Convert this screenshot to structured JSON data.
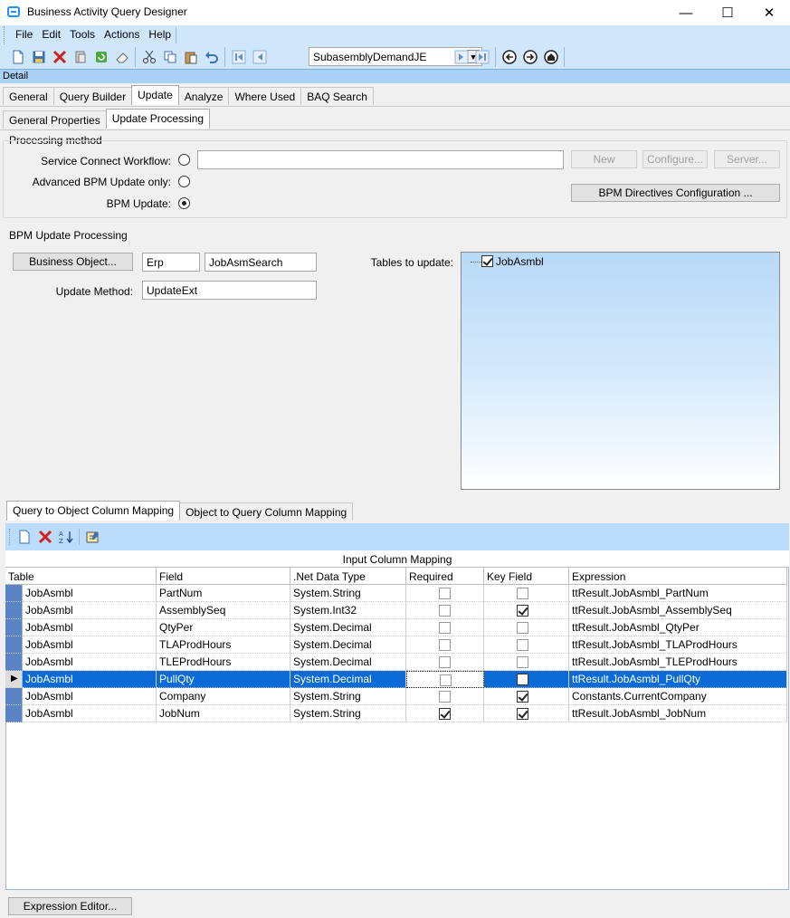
{
  "window": {
    "title": "Business Activity Query Designer"
  },
  "menu": [
    "File",
    "Edit",
    "Tools",
    "Actions",
    "Help"
  ],
  "toolbar": {
    "query_id": "SubasemblyDemandJE"
  },
  "detail_label": "Detail",
  "main_tabs": [
    "General",
    "Query Builder",
    "Update",
    "Analyze",
    "Where Used",
    "BAQ Search"
  ],
  "sub_tabs": [
    "General Properties",
    "Update  Processing"
  ],
  "processing": {
    "group_label": "Processing method",
    "service_connect_label": "Service Connect Workflow:",
    "advanced_bpm_label": "Advanced BPM Update only:",
    "bpm_update_label": "BPM Update:",
    "workflow_value": "",
    "new_button": "New",
    "configure_button": "Configure...",
    "server_button": "Server...",
    "bpm_directives_button": "BPM Directives Configuration ...",
    "selected": "bpm_update"
  },
  "bpm_update": {
    "group_label": "BPM Update Processing",
    "business_object_button": "Business Object...",
    "bo_namespace": "Erp",
    "bo_name": "JobAsmSearch",
    "update_method_label": "Update Method:",
    "update_method": "UpdateExt",
    "tables_label": "Tables to update:",
    "tables": [
      {
        "name": "JobAsmbl",
        "checked": true
      }
    ]
  },
  "mapping_tabs": [
    "Query to Object Column Mapping",
    "Object to Query Column Mapping"
  ],
  "grid": {
    "band_title": "Input Column Mapping",
    "columns": [
      "Table",
      "Field",
      ".Net Data Type",
      "Required",
      "Key Field",
      "Expression"
    ],
    "rows": [
      {
        "table": "JobAsmbl",
        "field": "PartNum",
        "type": "System.String",
        "required": false,
        "key": false,
        "expression": "ttResult.JobAsmbl_PartNum"
      },
      {
        "table": "JobAsmbl",
        "field": "AssemblySeq",
        "type": "System.Int32",
        "required": false,
        "key": true,
        "expression": "ttResult.JobAsmbl_AssemblySeq"
      },
      {
        "table": "JobAsmbl",
        "field": "QtyPer",
        "type": "System.Decimal",
        "required": false,
        "key": false,
        "expression": "ttResult.JobAsmbl_QtyPer"
      },
      {
        "table": "JobAsmbl",
        "field": "TLAProdHours",
        "type": "System.Decimal",
        "required": false,
        "key": false,
        "expression": "ttResult.JobAsmbl_TLAProdHours"
      },
      {
        "table": "JobAsmbl",
        "field": "TLEProdHours",
        "type": "System.Decimal",
        "required": false,
        "key": false,
        "expression": "ttResult.JobAsmbl_TLEProdHours"
      },
      {
        "table": "JobAsmbl",
        "field": "PullQty",
        "type": "System.Decimal",
        "required": false,
        "key": false,
        "expression": "ttResult.JobAsmbl_PullQty",
        "selected": true
      },
      {
        "table": "JobAsmbl",
        "field": "Company",
        "type": "System.String",
        "required": false,
        "key": true,
        "expression": "Constants.CurrentCompany"
      },
      {
        "table": "JobAsmbl",
        "field": "JobNum",
        "type": "System.String",
        "required": true,
        "key": true,
        "expression": "ttResult.JobAsmbl_JobNum"
      }
    ]
  },
  "expression_editor_button": "Expression Editor...",
  "colors": {
    "accent": "#0a6ad6",
    "band": "#cfe6fb",
    "row_header": "#5b84c4"
  }
}
